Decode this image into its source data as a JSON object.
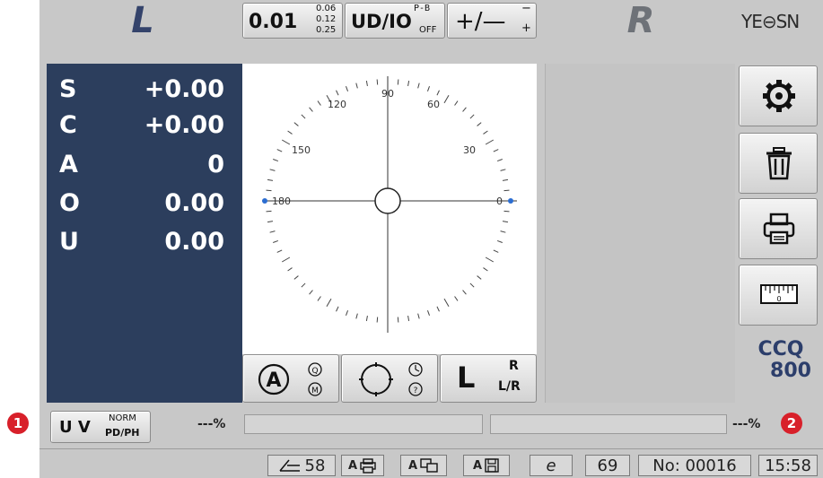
{
  "callouts": {
    "left": "1",
    "right": "2"
  },
  "header": {
    "left_eye": "L",
    "right_eye": "R",
    "brand": "YE⊖SN",
    "precision": {
      "main": "0.01",
      "opt1": "0.06",
      "opt2": "0.12",
      "opt3": "0.25"
    },
    "udio": {
      "label": "UD/IO",
      "sup": "P-B",
      "sub": "OFF"
    },
    "sign": {
      "label": "+/—",
      "sup": "−",
      "sub": "+"
    }
  },
  "measurements": [
    {
      "key": "S",
      "value": "+0.00"
    },
    {
      "key": "C",
      "value": "+0.00"
    },
    {
      "key": "A",
      "value": "0"
    },
    {
      "key": "O",
      "value": "0.00"
    },
    {
      "key": "U",
      "value": "0.00"
    }
  ],
  "protractor": {
    "labels": [
      "90",
      "120",
      "60",
      "150",
      "30",
      "180",
      "0"
    ]
  },
  "bottom": {
    "mode_a": {
      "main": "A",
      "opt1": "Q",
      "opt2": "M"
    },
    "eye_select": {
      "main": "L",
      "opt1": "R",
      "opt2": "L/R"
    }
  },
  "side": {
    "ccq_line1": "CCQ",
    "ccq_line2": "800"
  },
  "uv": {
    "label": "U V",
    "opt1": "NORM",
    "opt2": "PD/PH",
    "left_pct": "---%",
    "right_pct": "---%"
  },
  "status": {
    "count": "58",
    "e": "e",
    "num": "69",
    "no": "No: 00016",
    "time": "15:58"
  },
  "colors": {
    "panel": "#2c3e5d",
    "accent_red": "#d8202a",
    "header_text": "#34436b"
  }
}
